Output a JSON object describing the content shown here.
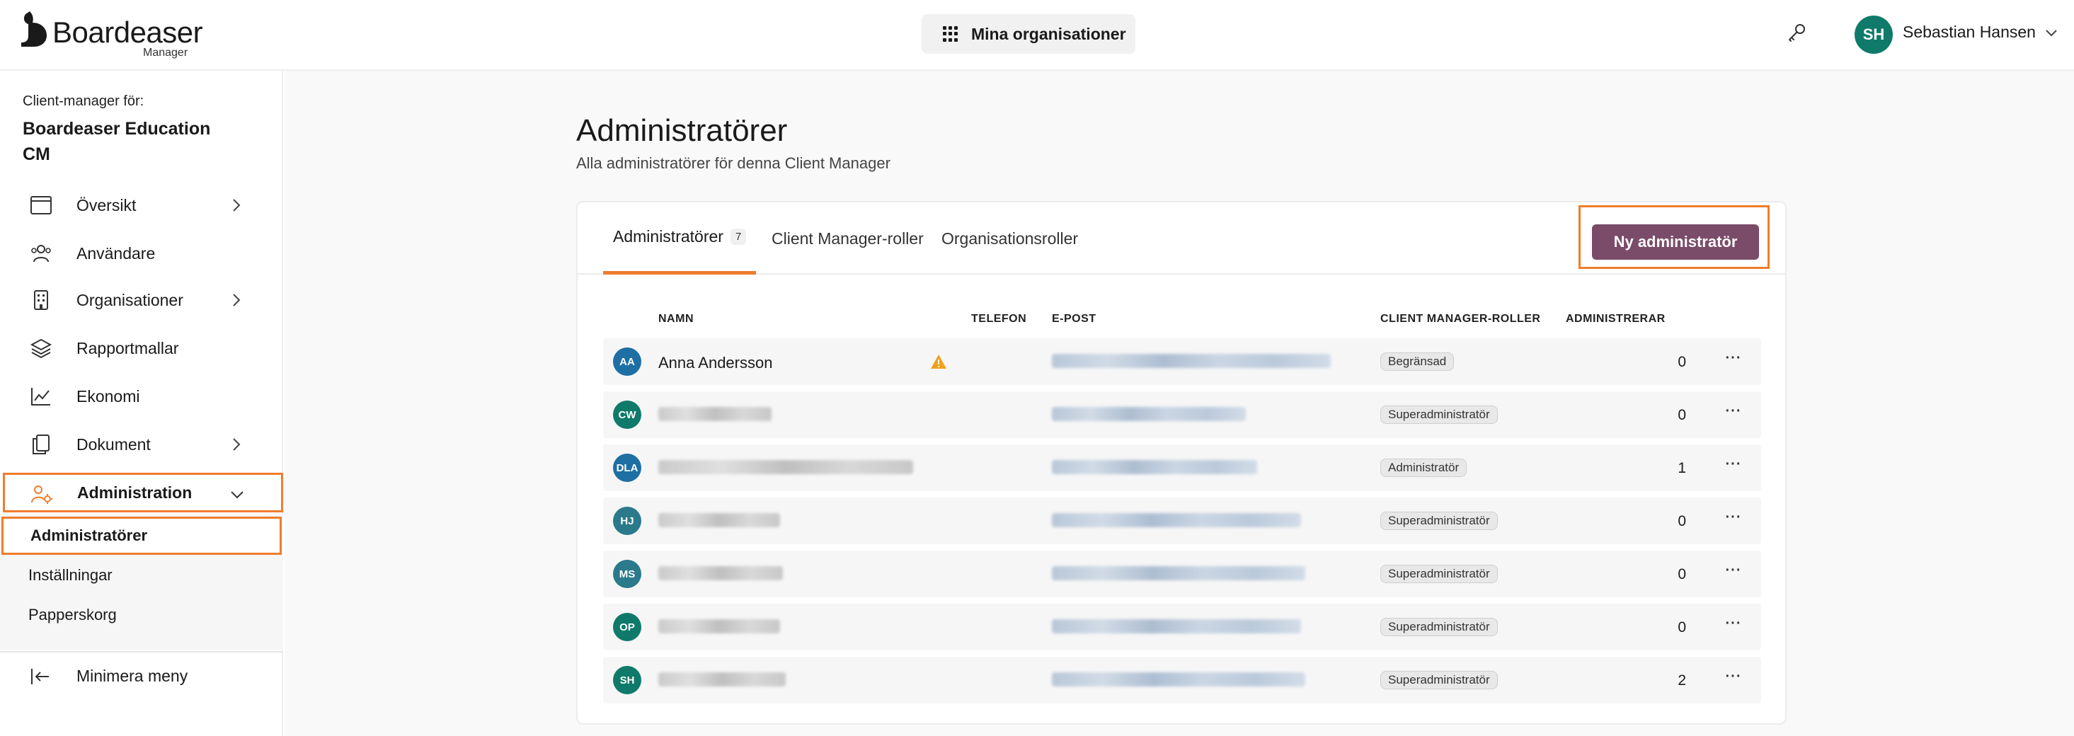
{
  "brand": {
    "name": "Boardeaser",
    "sub": "Manager"
  },
  "header": {
    "org_button": "Mina organisationer",
    "user": {
      "initials": "SH",
      "name": "Sebastian Hansen",
      "avatar_color": "#0f7a6a"
    }
  },
  "sidebar": {
    "context_label": "Client-manager för:",
    "context_name": "Boardeaser Education CM",
    "items": [
      {
        "label": "Översikt",
        "icon": "calendar-window-icon",
        "chevron": "right"
      },
      {
        "label": "Användare",
        "icon": "users-icon"
      },
      {
        "label": "Organisationer",
        "icon": "building-icon",
        "chevron": "right"
      },
      {
        "label": "Rapportmallar",
        "icon": "layers-icon"
      },
      {
        "label": "Ekonomi",
        "icon": "chart-line-icon"
      },
      {
        "label": "Dokument",
        "icon": "documents-icon",
        "chevron": "right"
      },
      {
        "label": "Administration",
        "icon": "admin-users-gear-icon",
        "chevron": "down",
        "active": true
      }
    ],
    "sub_items": [
      {
        "label": "Administratörer",
        "active": true
      },
      {
        "label": "Inställningar"
      },
      {
        "label": "Papperskorg"
      }
    ],
    "minimize": "Minimera meny"
  },
  "main": {
    "title": "Administratörer",
    "subtitle": "Alla administratörer för denna Client Manager",
    "tabs": [
      {
        "label": "Administratörer",
        "count": "7",
        "active": true
      },
      {
        "label": "Client Manager-roller"
      },
      {
        "label": "Organisationsroller"
      }
    ],
    "new_button": "Ny administratör",
    "columns": {
      "name": "NAMN",
      "phone": "TELEFON",
      "email": "E-POST",
      "roles": "CLIENT MANAGER-ROLLER",
      "administers": "ADMINISTRERAR"
    },
    "rows": [
      {
        "initials": "AA",
        "name": "Anna Andersson",
        "warning": true,
        "role": "Begränsad",
        "administers": "0",
        "color": "#1e6fa3"
      },
      {
        "initials": "CW",
        "name": "",
        "role": "Superadministratör",
        "administers": "0",
        "color": "#0f7a6a"
      },
      {
        "initials": "DLA",
        "name": "",
        "role": "Administratör",
        "administers": "1",
        "color": "#1e6fa3"
      },
      {
        "initials": "HJ",
        "name": "",
        "role": "Superadministratör",
        "administers": "0",
        "color": "#2a7a8c"
      },
      {
        "initials": "MS",
        "name": "",
        "role": "Superadministratör",
        "administers": "0",
        "color": "#2a7a8c"
      },
      {
        "initials": "OP",
        "name": "",
        "role": "Superadministratör",
        "administers": "0",
        "color": "#0f7a6a"
      },
      {
        "initials": "SH",
        "name": "",
        "role": "Superadministratör",
        "administers": "2",
        "color": "#0f7a6a"
      }
    ]
  }
}
